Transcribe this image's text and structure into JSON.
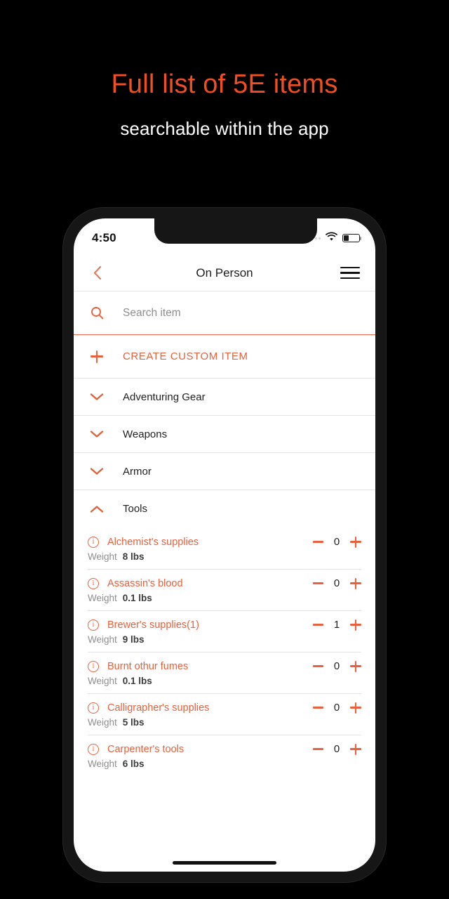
{
  "promo": {
    "title": "Full list of 5E items",
    "subtitle": "searchable within the app",
    "title_color": "#F04E23",
    "subtitle_color": "#FFFFFF",
    "background_color": "#000000"
  },
  "theme": {
    "accent": "#E8603C",
    "screen_background": "#FFFFFF",
    "text_primary": "#1C1C1C",
    "text_muted": "#8E8E8E"
  },
  "status_bar": {
    "time": "4:50",
    "signal_icon": "signal-dots-icon",
    "wifi_icon": "wifi-icon",
    "battery_icon": "battery-icon",
    "battery_level": "32%"
  },
  "nav_bar": {
    "back_icon": "chevron-left-icon",
    "title": "On Person",
    "menu_icon": "hamburger-menu-icon"
  },
  "search": {
    "icon": "search-icon",
    "value": "",
    "placeholder": "Search item"
  },
  "create_custom": {
    "icon": "plus-icon",
    "label": "CREATE CUSTOM ITEM"
  },
  "categories": [
    {
      "label": "Adventuring Gear",
      "expanded": false,
      "icon": "chevron-down-icon"
    },
    {
      "label": "Weapons",
      "expanded": false,
      "icon": "chevron-down-icon"
    },
    {
      "label": "Armor",
      "expanded": false,
      "icon": "chevron-down-icon"
    },
    {
      "label": "Tools",
      "expanded": true,
      "icon": "chevron-up-icon"
    }
  ],
  "weight_label": "Weight",
  "items": [
    {
      "name": "Alchemist's supplies",
      "weight": "8 lbs",
      "count": "0"
    },
    {
      "name": "Assassin's blood",
      "weight": "0.1 lbs",
      "count": "0"
    },
    {
      "name": "Brewer's supplies(1)",
      "weight": "9 lbs",
      "count": "1"
    },
    {
      "name": "Burnt othur fumes",
      "weight": "0.1 lbs",
      "count": "0"
    },
    {
      "name": "Calligrapher's supplies",
      "weight": "5 lbs",
      "count": "0"
    },
    {
      "name": "Carpenter's tools",
      "weight": "6 lbs",
      "count": "0"
    }
  ]
}
